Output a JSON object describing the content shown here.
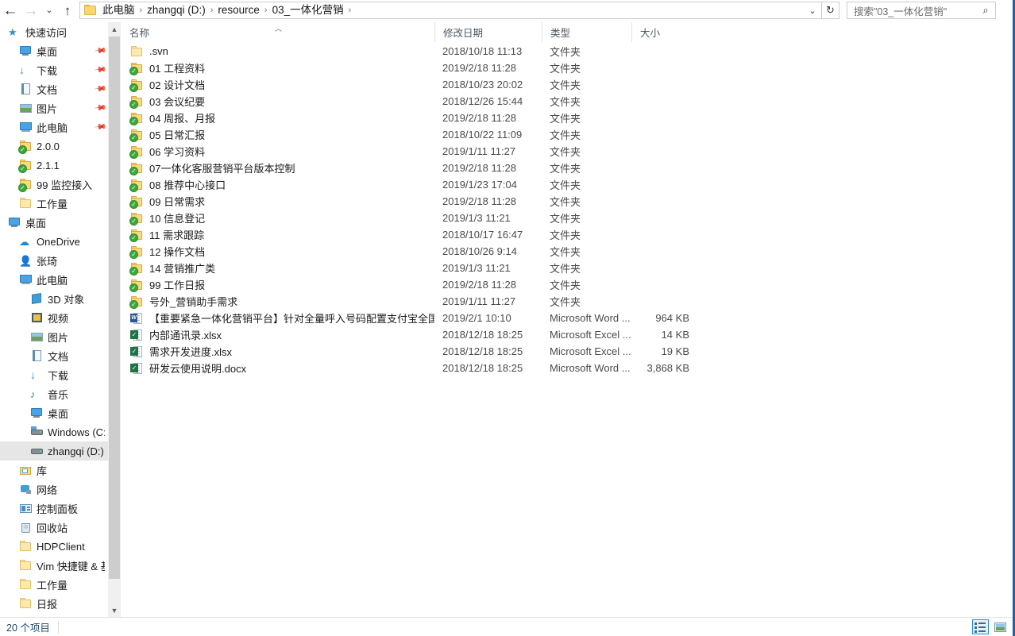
{
  "window": {
    "title": "03_一体化营销",
    "accent_blue": "#2a8ed6",
    "selection_gray": "#e6e6e6"
  },
  "nav": {
    "back_label": "←",
    "forward_label": "→",
    "recent_label": "⌄",
    "up_label": "↑",
    "dropdown_label": "⌄",
    "refresh_label": "↻"
  },
  "breadcrumb": {
    "separator": "›",
    "items": [
      "此电脑",
      "zhangqi (D:)",
      "resource",
      "03_一体化营销"
    ]
  },
  "search": {
    "placeholder": "搜索\"03_一体化营销\"",
    "icon": "search-icon",
    "icon_glyph": "⌕"
  },
  "sidebar": {
    "items": [
      {
        "label": "快速访问",
        "icon": "star-icon",
        "indent": 0,
        "pinned": false,
        "selected": false
      },
      {
        "label": "桌面",
        "icon": "desktop-icon",
        "indent": 1,
        "pinned": true,
        "selected": false
      },
      {
        "label": "下载",
        "icon": "download-icon",
        "indent": 1,
        "pinned": true,
        "selected": false
      },
      {
        "label": "文档",
        "icon": "documents-icon",
        "indent": 1,
        "pinned": true,
        "selected": false
      },
      {
        "label": "图片",
        "icon": "pictures-icon",
        "indent": 1,
        "pinned": true,
        "selected": false
      },
      {
        "label": "此电脑",
        "icon": "this-pc-icon",
        "indent": 1,
        "pinned": true,
        "selected": false
      },
      {
        "label": "2.0.0",
        "icon": "folder-svn-icon",
        "indent": 1,
        "pinned": false,
        "selected": false
      },
      {
        "label": "2.1.1",
        "icon": "folder-svn-icon",
        "indent": 1,
        "pinned": false,
        "selected": false
      },
      {
        "label": "99 监控接入",
        "icon": "folder-svn-icon",
        "indent": 1,
        "pinned": false,
        "selected": false
      },
      {
        "label": "工作量",
        "icon": "folder-icon",
        "indent": 1,
        "pinned": false,
        "selected": false
      },
      {
        "label": "桌面",
        "icon": "desktop-icon",
        "indent": 0,
        "pinned": false,
        "selected": false
      },
      {
        "label": "OneDrive",
        "icon": "onedrive-icon",
        "indent": 1,
        "pinned": false,
        "selected": false
      },
      {
        "label": "张琦",
        "icon": "user-icon",
        "indent": 1,
        "pinned": false,
        "selected": false
      },
      {
        "label": "此电脑",
        "icon": "this-pc-icon",
        "indent": 1,
        "pinned": false,
        "selected": false
      },
      {
        "label": "3D 对象",
        "icon": "3d-objects-icon",
        "indent": 2,
        "pinned": false,
        "selected": false
      },
      {
        "label": "视频",
        "icon": "videos-icon",
        "indent": 2,
        "pinned": false,
        "selected": false
      },
      {
        "label": "图片",
        "icon": "pictures-icon",
        "indent": 2,
        "pinned": false,
        "selected": false
      },
      {
        "label": "文档",
        "icon": "documents-icon",
        "indent": 2,
        "pinned": false,
        "selected": false
      },
      {
        "label": "下载",
        "icon": "download-icon",
        "indent": 2,
        "pinned": false,
        "selected": false
      },
      {
        "label": "音乐",
        "icon": "music-icon",
        "indent": 2,
        "pinned": false,
        "selected": false
      },
      {
        "label": "桌面",
        "icon": "desktop-icon",
        "indent": 2,
        "pinned": false,
        "selected": false
      },
      {
        "label": "Windows (C:)",
        "icon": "windows-drive-icon",
        "indent": 2,
        "pinned": false,
        "selected": false
      },
      {
        "label": "zhangqi (D:)",
        "icon": "drive-icon",
        "indent": 2,
        "pinned": false,
        "selected": true
      },
      {
        "label": "库",
        "icon": "library-icon",
        "indent": 1,
        "pinned": false,
        "selected": false
      },
      {
        "label": "网络",
        "icon": "network-icon",
        "indent": 1,
        "pinned": false,
        "selected": false
      },
      {
        "label": "控制面板",
        "icon": "control-panel-icon",
        "indent": 1,
        "pinned": false,
        "selected": false
      },
      {
        "label": "回收站",
        "icon": "recycle-bin-icon",
        "indent": 1,
        "pinned": false,
        "selected": false
      },
      {
        "label": "HDPClient",
        "icon": "folder-icon",
        "indent": 1,
        "pinned": false,
        "selected": false
      },
      {
        "label": "Vim 快捷键 & 基",
        "icon": "folder-icon",
        "indent": 1,
        "pinned": false,
        "selected": false
      },
      {
        "label": "工作量",
        "icon": "folder-icon",
        "indent": 1,
        "pinned": false,
        "selected": false
      },
      {
        "label": "日报",
        "icon": "folder-icon",
        "indent": 1,
        "pinned": false,
        "selected": false
      }
    ]
  },
  "columns": {
    "name": "名称",
    "date": "修改日期",
    "type": "类型",
    "size": "大小",
    "sorted_by": "名称",
    "sort_caret": "︿"
  },
  "files": [
    {
      "name": ".svn",
      "date": "2018/10/18 11:13",
      "type": "文件夹",
      "size": "",
      "icon": "folder-icon"
    },
    {
      "name": "01 工程资料",
      "date": "2019/2/18 11:28",
      "type": "文件夹",
      "size": "",
      "icon": "folder-svn-icon"
    },
    {
      "name": "02 设计文档",
      "date": "2018/10/23 20:02",
      "type": "文件夹",
      "size": "",
      "icon": "folder-svn-icon"
    },
    {
      "name": "03 会议纪要",
      "date": "2018/12/26 15:44",
      "type": "文件夹",
      "size": "",
      "icon": "folder-svn-icon"
    },
    {
      "name": "04 周报、月报",
      "date": "2019/2/18 11:28",
      "type": "文件夹",
      "size": "",
      "icon": "folder-svn-icon"
    },
    {
      "name": "05 日常汇报",
      "date": "2018/10/22 11:09",
      "type": "文件夹",
      "size": "",
      "icon": "folder-svn-icon"
    },
    {
      "name": "06 学习资料",
      "date": "2019/1/11 11:27",
      "type": "文件夹",
      "size": "",
      "icon": "folder-svn-icon"
    },
    {
      "name": "07一体化客服营销平台版本控制",
      "date": "2019/2/18 11:28",
      "type": "文件夹",
      "size": "",
      "icon": "folder-svn-icon"
    },
    {
      "name": "08 推荐中心接口",
      "date": "2019/1/23 17:04",
      "type": "文件夹",
      "size": "",
      "icon": "folder-svn-icon"
    },
    {
      "name": "09 日常需求",
      "date": "2019/2/18 11:28",
      "type": "文件夹",
      "size": "",
      "icon": "folder-svn-icon"
    },
    {
      "name": "10 信息登记",
      "date": "2019/1/3 11:21",
      "type": "文件夹",
      "size": "",
      "icon": "folder-svn-icon"
    },
    {
      "name": "11 需求跟踪",
      "date": "2018/10/17 16:47",
      "type": "文件夹",
      "size": "",
      "icon": "folder-svn-icon"
    },
    {
      "name": "12 操作文档",
      "date": "2018/10/26 9:14",
      "type": "文件夹",
      "size": "",
      "icon": "folder-svn-icon"
    },
    {
      "name": "14 营销推广类",
      "date": "2019/1/3 11:21",
      "type": "文件夹",
      "size": "",
      "icon": "folder-svn-icon"
    },
    {
      "name": "99 工作日报",
      "date": "2019/2/18 11:28",
      "type": "文件夹",
      "size": "",
      "icon": "folder-svn-icon"
    },
    {
      "name": "号外_营销助手需求",
      "date": "2019/1/11 11:27",
      "type": "文件夹",
      "size": "",
      "icon": "folder-svn-icon"
    },
    {
      "name": "【重要紧急一体化营销平台】针对全量呼入号码配置支付宝全国类...",
      "date": "2019/2/1 10:10",
      "type": "Microsoft Word ...",
      "size": "964 KB",
      "icon": "word-doc-icon"
    },
    {
      "name": "内部通讯录.xlsx",
      "date": "2018/12/18 18:25",
      "type": "Microsoft Excel ...",
      "size": "14 KB",
      "icon": "excel-svn-icon"
    },
    {
      "name": "需求开发进度.xlsx",
      "date": "2018/12/18 18:25",
      "type": "Microsoft Excel ...",
      "size": "19 KB",
      "icon": "excel-svn-icon"
    },
    {
      "name": "研发云使用说明.docx",
      "date": "2018/12/18 18:25",
      "type": "Microsoft Word ...",
      "size": "3,868 KB",
      "icon": "word-svn-icon"
    }
  ],
  "status": {
    "item_count": "20 个项目",
    "view_details": "details-view",
    "view_tiles": "large-icons-view"
  }
}
